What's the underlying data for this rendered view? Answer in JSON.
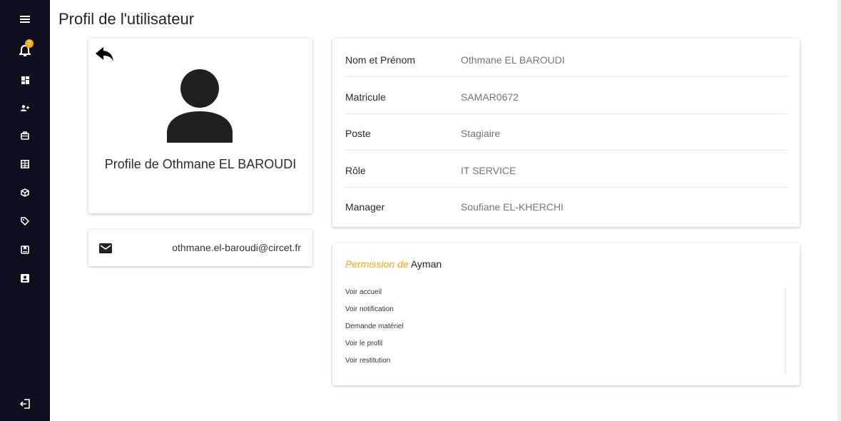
{
  "sidebar": {
    "items": [
      {
        "icon": "menu-icon"
      },
      {
        "icon": "bell-icon",
        "badge": "0"
      },
      {
        "icon": "dashboard-icon"
      },
      {
        "icon": "add-user-icon"
      },
      {
        "icon": "briefcase-icon"
      },
      {
        "icon": "table-icon"
      },
      {
        "icon": "cube-icon"
      },
      {
        "icon": "tag-icon"
      },
      {
        "icon": "bookmark-icon"
      },
      {
        "icon": "contact-card-icon"
      },
      {
        "icon": "logout-icon"
      }
    ]
  },
  "page": {
    "title": "Profil de l'utilisateur"
  },
  "profile": {
    "name_label": "Profile de Othmane EL BAROUDI",
    "email": "othmane.el-baroudi@circet.fr"
  },
  "info": {
    "rows": [
      {
        "label": "Nom et Prénom",
        "value": "Othmane EL BAROUDI"
      },
      {
        "label": "Matricule",
        "value": "SAMAR0672"
      },
      {
        "label": "Poste",
        "value": "Stagiaire"
      },
      {
        "label": "Rôle",
        "value": "IT SERVICE"
      },
      {
        "label": "Manager",
        "value": "Soufiane EL-KHERCHI"
      }
    ]
  },
  "permissions": {
    "title_prefix": "Permission de",
    "title_name": "Ayman",
    "items": [
      "Voir accueil",
      "Voir notification",
      "Demande matériel",
      "Voir le profil",
      "Voir restitution"
    ]
  },
  "colors": {
    "sidebar_bg": "#0d0f1c",
    "accent": "#f5a623"
  }
}
